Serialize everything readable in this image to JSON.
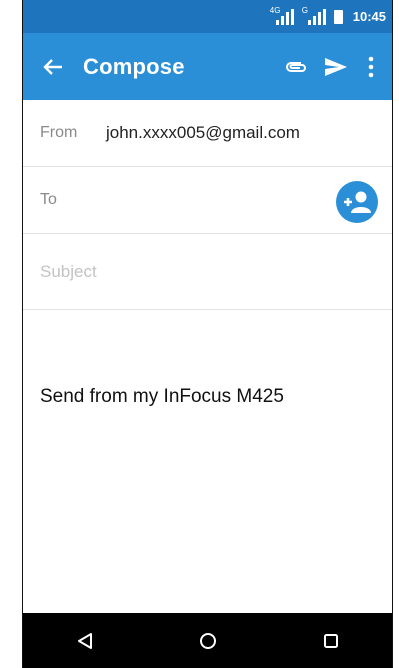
{
  "status_bar": {
    "network_tag_1": "4G",
    "network_tag_2": "G",
    "time": "10:45"
  },
  "app_bar": {
    "title": "Compose",
    "icons": [
      "back-arrow-icon",
      "attach-icon",
      "send-icon",
      "overflow-menu-icon"
    ]
  },
  "compose": {
    "from_label": "From",
    "from_value": "john.xxxx005@gmail.com",
    "to_label": "To",
    "subject_placeholder": "Subject",
    "body": "Send from my  InFocus M425"
  },
  "navigation": {
    "icons": [
      "back-triangle-icon",
      "home-circle-icon",
      "recents-square-icon"
    ]
  },
  "colors": {
    "status_bar": "#1f75bd",
    "app_bar": "#2b8fd8",
    "accent": "#2b8fd8",
    "nav_bar": "#000000"
  }
}
